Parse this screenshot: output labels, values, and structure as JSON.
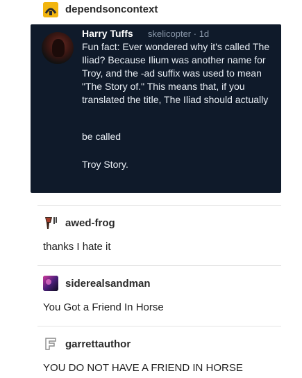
{
  "reblogs": [
    {
      "username": "dependsoncontext"
    },
    {
      "username": "awed-frog",
      "text": "thanks I hate it"
    },
    {
      "username": "siderealsandman",
      "text": "You Got a Friend In Horse"
    },
    {
      "username": "garrettauthor",
      "text": "YOU DO NOT HAVE A FRIEND IN HORSE"
    }
  ],
  "tweet": {
    "name": "Harry Tuffs",
    "handle_time": "skelicopter · 1d",
    "body": "Fun fact: Ever wondered why it's called The Iliad? Because Ilium was another name for Troy, and the -ad suffix was used to mean \"The Story of.\" This means that, if you translated the title, The Iliad should actually",
    "line2": "be called",
    "line3": "Troy Story."
  },
  "colors": {
    "tweet_background": "#0f1a2a",
    "depends_avatar": "#f2b50f"
  }
}
